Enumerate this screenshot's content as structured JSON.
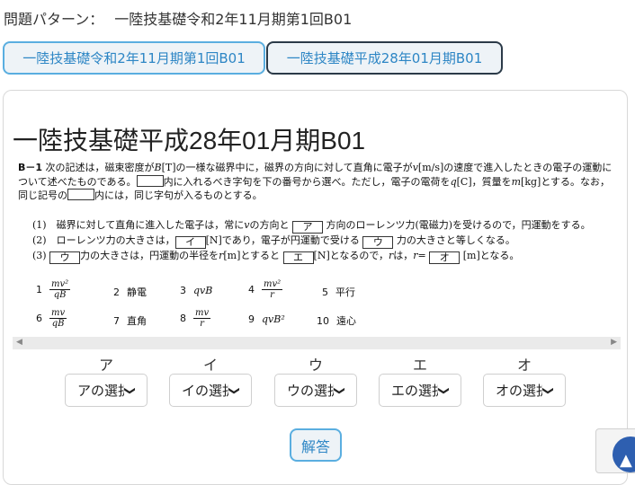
{
  "header": {
    "pattern_label": "問題パターン：",
    "pattern_value": "一陸技基礎令和2年11月期第1回B01"
  },
  "tabs": [
    {
      "label": "一陸技基礎令和2年11月期第1回B01"
    },
    {
      "label": "一陸技基礎平成28年01月期B01"
    }
  ],
  "question": {
    "title": "一陸技基礎平成28年01月期B01",
    "number": "B－1",
    "intro_1": "次の記述は，磁束密度が",
    "intro_B": "B",
    "intro_2": "[T]の一様な磁界中に，磁界の方向に対して直角に電子が",
    "intro_v": "v",
    "intro_3": "[m/s]の速度で進入したときの電子の運動について述べたものである。",
    "intro_4": "内に入れるべき字句を下の番号から選べ。ただし，電子の電荷を",
    "intro_q": "q",
    "intro_5": "[C]，質量を",
    "intro_m": "m",
    "intro_6": "[kg]とする。なお，同じ記号の",
    "intro_7": "内には，同じ字句が入るものとする。",
    "item1_a": "(1)　磁界に対して直角に進入した電子は，常に",
    "item1_v": "v",
    "item1_b": "の方向と",
    "item1_box": "ア",
    "item1_c": "方向のローレンツ力(電磁力)を受けるので，円運動をする。",
    "item2_a": "(2)　ローレンツ力の大きさは，",
    "item2_box1": "イ",
    "item2_b": "[N]であり，電子が円運動で受ける",
    "item2_box2": "ウ",
    "item2_c": "力の大きさと等しくなる。",
    "item3_a": "(3)",
    "item3_box1": "ウ",
    "item3_b": "力の大きさは，円運動の半径を",
    "item3_r": "r",
    "item3_c": "[m]とすると",
    "item3_box2": "エ",
    "item3_d": "[N]となるので，",
    "item3_r2": "r",
    "item3_e": "は，",
    "item3_r3": "r",
    "item3_f": "=",
    "item3_box3": "オ",
    "item3_g": "[m]となる。",
    "choices": [
      {
        "num": "1",
        "top": "mv²",
        "bot": "qB"
      },
      {
        "num": "2",
        "text": "静電"
      },
      {
        "num": "3",
        "text": "qvB"
      },
      {
        "num": "4",
        "top": "mv²",
        "bot": "r"
      },
      {
        "num": "5",
        "text": "平行"
      },
      {
        "num": "6",
        "top": "mv",
        "bot": "qB"
      },
      {
        "num": "7",
        "text": "直角"
      },
      {
        "num": "8",
        "top": "mv",
        "bot": "r"
      },
      {
        "num": "9",
        "text": "qvB²"
      },
      {
        "num": "10",
        "text": "遠心"
      }
    ]
  },
  "answers": [
    {
      "label": "ア",
      "select": "アの選択"
    },
    {
      "label": "イ",
      "select": "イの選択"
    },
    {
      "label": "ウ",
      "select": "ウの選択"
    },
    {
      "label": "エ",
      "select": "エの選択"
    },
    {
      "label": "オ",
      "select": "オの選択"
    }
  ],
  "submit_label": "解答"
}
